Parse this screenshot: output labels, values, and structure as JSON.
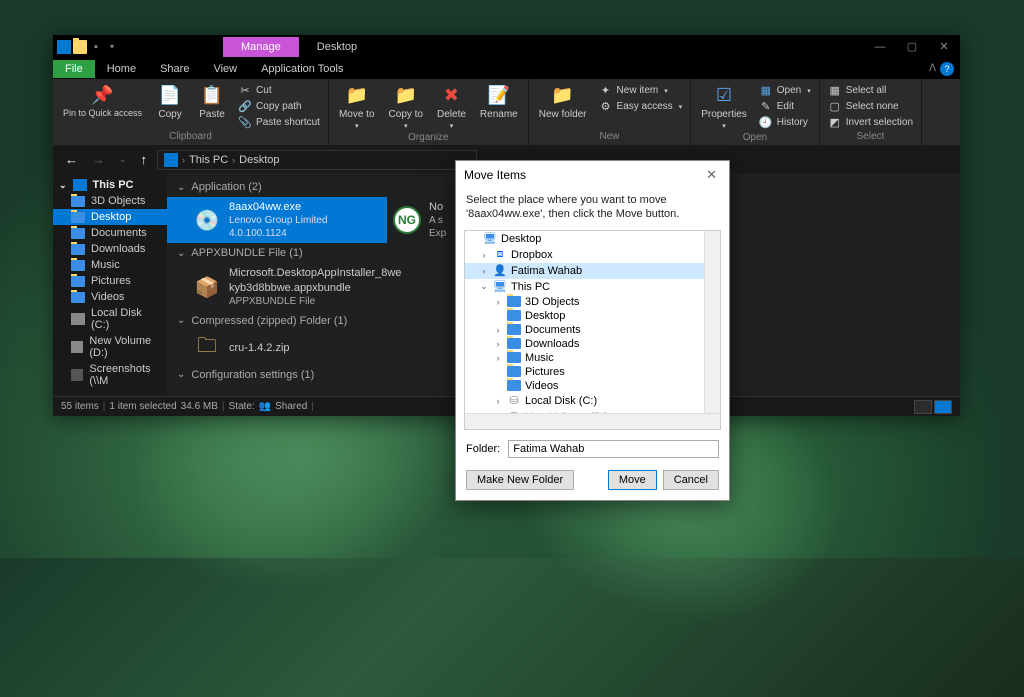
{
  "titlebar": {
    "manage": "Manage",
    "desktop": "Desktop"
  },
  "tabs": {
    "file": "File",
    "home": "Home",
    "share": "Share",
    "view": "View",
    "apptools": "Application Tools"
  },
  "ribbon": {
    "pin": "Pin to Quick access",
    "copy": "Copy",
    "paste": "Paste",
    "cut": "Cut",
    "copypath": "Copy path",
    "pasteshortcut": "Paste shortcut",
    "moveto": "Move to",
    "copyto": "Copy to",
    "delete": "Delete",
    "rename": "Rename",
    "newitem": "New item",
    "easyaccess": "Easy access",
    "newfolder": "New folder",
    "properties": "Properties",
    "open": "Open",
    "edit": "Edit",
    "history": "History",
    "selectall": "Select all",
    "selectnone": "Select none",
    "invert": "Invert selection",
    "g_clipboard": "Clipboard",
    "g_organize": "Organize",
    "g_new": "New",
    "g_open": "Open",
    "g_select": "Select"
  },
  "address": {
    "thispc": "This PC",
    "desktop": "Desktop"
  },
  "sidebar": {
    "thispc": "This PC",
    "items": [
      "3D Objects",
      "Desktop",
      "Documents",
      "Downloads",
      "Music",
      "Pictures",
      "Videos",
      "Local Disk (C:)",
      "New Volume (D:)",
      "Screenshots (\\\\M"
    ]
  },
  "groups": {
    "app": "Application (2)",
    "appx": "APPXBUNDLE File (1)",
    "zip": "Compressed (zipped) Folder (1)",
    "cfg": "Configuration settings (1)"
  },
  "files": {
    "f1": {
      "name": "8aax04ww.exe",
      "sub1": "Lenovo Group Limited",
      "sub2": "4.0.100.1124"
    },
    "f2a": "No",
    "f2b": "A s",
    "f2c": "Exp",
    "f3": {
      "name": "Microsoft.DesktopAppInstaller_8we kyb3d8bbwe.appxbundle",
      "sub": "APPXBUNDLE File"
    },
    "f4": {
      "name": "cru-1.4.2.zip"
    }
  },
  "status": {
    "items": "55 items",
    "selected": "1 item selected",
    "size": "34.6 MB",
    "state": "State:",
    "shared": "Shared"
  },
  "dialog": {
    "title": "Move Items",
    "msg": "Select the place where you want to move '8aax04ww.exe', then click the Move button.",
    "tree": [
      "Desktop",
      "Dropbox",
      "Fatima Wahab",
      "This PC",
      "3D Objects",
      "Desktop",
      "Documents",
      "Downloads",
      "Music",
      "Pictures",
      "Videos",
      "Local Disk (C:)",
      "New Volume (D:)"
    ],
    "folder_label": "Folder:",
    "folder_value": "Fatima Wahab",
    "makenew": "Make New Folder",
    "move": "Move",
    "cancel": "Cancel"
  }
}
